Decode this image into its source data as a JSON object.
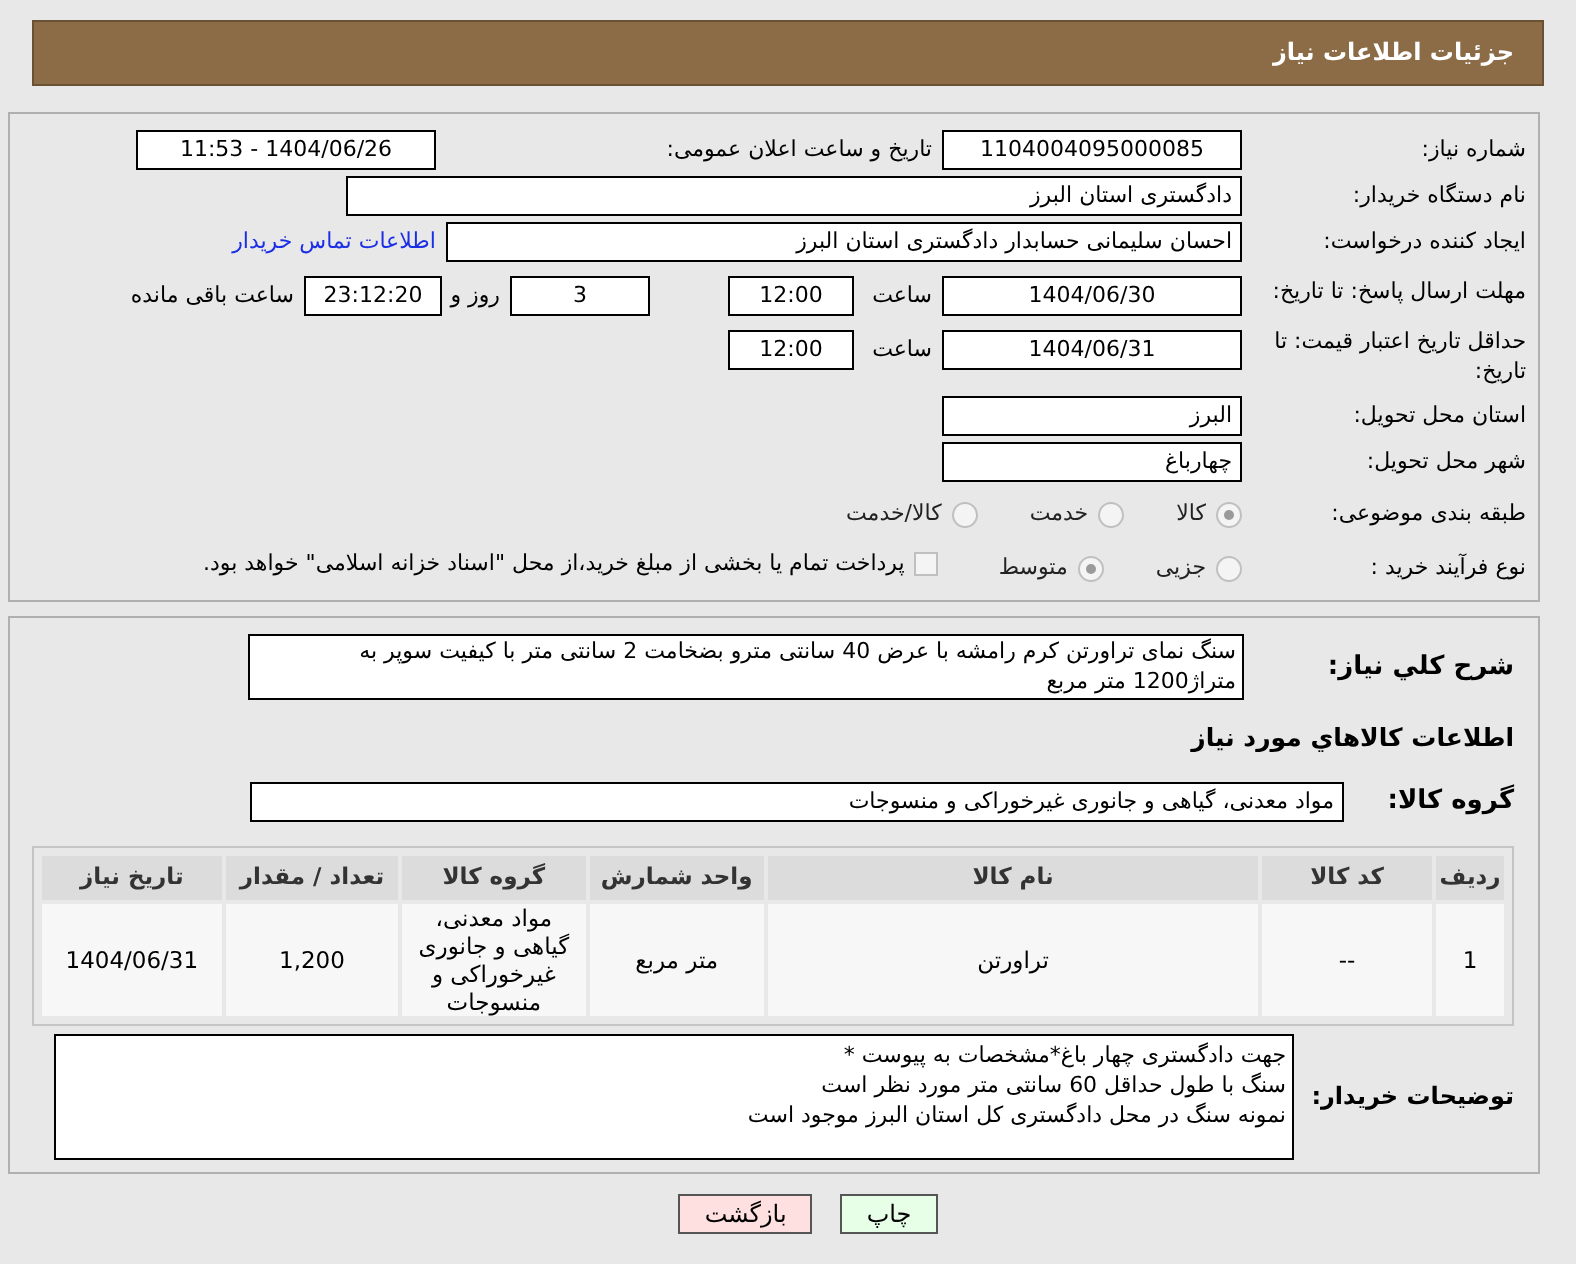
{
  "header": {
    "title": "جزئیات اطلاعات نیاز"
  },
  "need_number": {
    "label": "شماره نیاز:",
    "value": "1104004095000085"
  },
  "announce": {
    "label": "تاریخ و ساعت اعلان عمومی:",
    "value": "1404/06/26 - 11:53"
  },
  "buyer_org": {
    "label": "نام دستگاه خریدار:",
    "value": "دادگستری استان البرز"
  },
  "requester": {
    "label": "ایجاد کننده درخواست:",
    "value": "احسان سلیمانی حسابدار دادگستری استان البرز",
    "link": "اطلاعات تماس خریدار"
  },
  "response_deadline": {
    "label": "مهلت ارسال پاسخ: تا تاریخ:",
    "date": "1404/06/30",
    "time_label": "ساعت",
    "time": "12:00",
    "days": "3",
    "days_label": "روز و",
    "remaining": "23:12:20",
    "remaining_label": "ساعت باقی مانده"
  },
  "price_validity": {
    "label": "حداقل تاریخ اعتبار قیمت: تا تاریخ:",
    "date": "1404/06/31",
    "time_label": "ساعت",
    "time": "12:00"
  },
  "province": {
    "label": "استان محل تحویل:",
    "value": "البرز"
  },
  "city": {
    "label": "شهر محل تحویل:",
    "value": "چهارباغ"
  },
  "category": {
    "label": "طبقه بندی موضوعی:",
    "options": [
      {
        "label": "کالا",
        "selected": true
      },
      {
        "label": "خدمت",
        "selected": false
      },
      {
        "label": "کالا/خدمت",
        "selected": false
      }
    ]
  },
  "process": {
    "label": "نوع فرآیند خرید :",
    "options": [
      {
        "label": "جزیی",
        "selected": false
      },
      {
        "label": "متوسط",
        "selected": true
      }
    ],
    "payment": {
      "label": "پرداخت تمام یا بخشی از مبلغ خرید،از محل \"اسناد خزانه اسلامی\" خواهد بود.",
      "checked": false
    }
  },
  "description": {
    "label": "شرح کلي نیاز:",
    "value": "سنگ نمای تراورتن کرم رامشه با عرض 40 سانتی مترو بضخامت 2 سانتی متر با کیفیت سوپر به متراژ1200 متر مربع"
  },
  "goods_title": "اطلاعات کالاهاي مورد نیاز",
  "goods_group": {
    "label": "گروه کالا:",
    "value": "مواد معدنی، گیاهی و جانوری غیرخوراکی و منسوجات"
  },
  "table": {
    "columns": [
      "ردیف",
      "کد کالا",
      "نام کالا",
      "واحد شمارش",
      "گروه کالا",
      "تعداد / مقدار",
      "تاریخ نیاز"
    ],
    "rows": [
      [
        "1",
        "--",
        "تراورتن",
        "متر مربع",
        "مواد معدنی، گیاهی و جانوری غیرخوراکی و منسوجات",
        "1,200",
        "1404/06/31"
      ]
    ]
  },
  "buyer_notes": {
    "label": "توضیحات خریدار:",
    "lines": [
      "جهت دادگستری چهار باغ*مشخصات به پیوست *",
      "سنگ با طول حداقل 60 سانتی متر مورد نظر است",
      "نمونه سنگ در محل دادگستری کل استان البرز موجود است"
    ]
  },
  "buttons": [
    {
      "label": "چاپ",
      "kind": "print"
    },
    {
      "label": "بازگشت",
      "kind": "back"
    }
  ]
}
